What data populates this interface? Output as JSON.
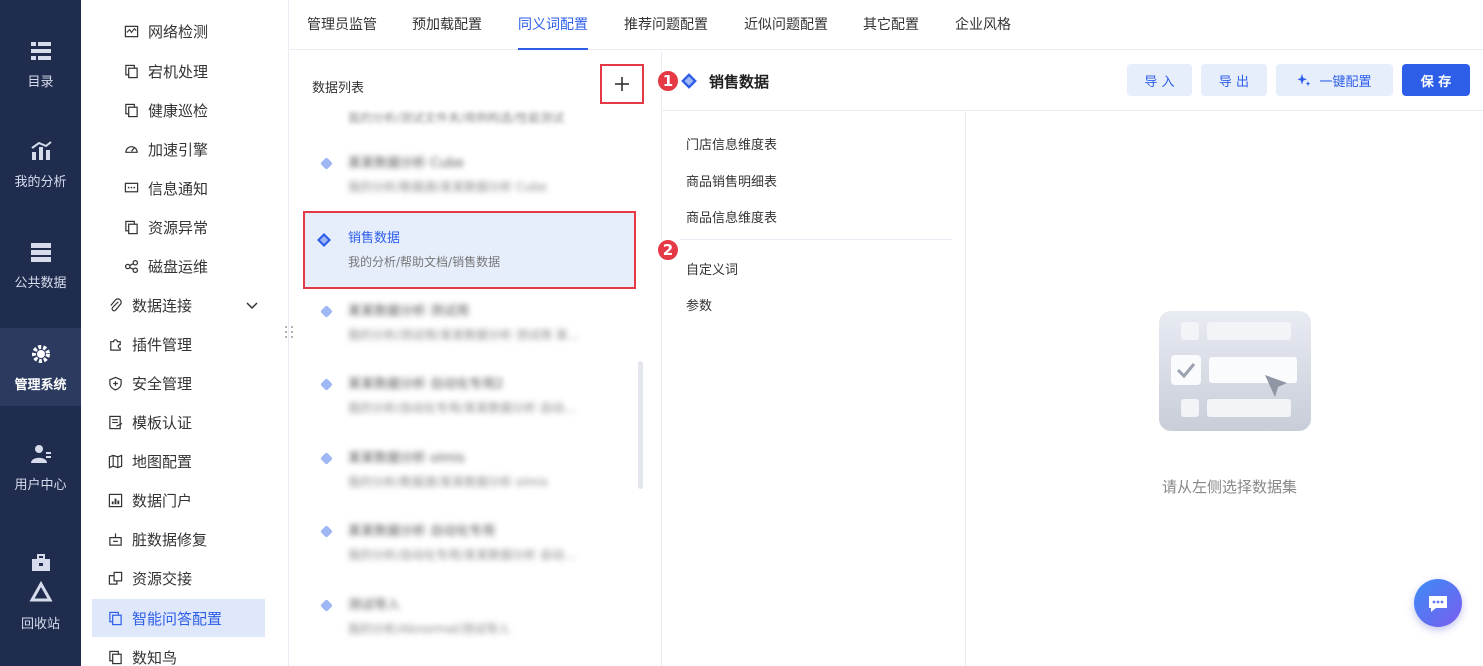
{
  "rail": {
    "items": [
      {
        "label": "目录",
        "icon": "catalog-icon"
      },
      {
        "label": "我的分析",
        "icon": "analysis-icon"
      },
      {
        "label": "公共数据",
        "icon": "public-data-icon"
      },
      {
        "label": "管理系统",
        "icon": "gear-icon",
        "active": true
      },
      {
        "label": "用户中心",
        "icon": "user-icon"
      },
      {
        "label": "回收站",
        "icon": "recycle-icon"
      }
    ]
  },
  "menu": {
    "sub_items": [
      {
        "label": "网络检测",
        "icon": "network-check-icon"
      },
      {
        "label": "宕机处理",
        "icon": "document-icon"
      },
      {
        "label": "健康巡检",
        "icon": "document-icon"
      },
      {
        "label": "加速引擎",
        "icon": "speed-icon"
      },
      {
        "label": "信息通知",
        "icon": "message-icon"
      },
      {
        "label": "资源异常",
        "icon": "document-icon"
      },
      {
        "label": "磁盘运维",
        "icon": "share-icon"
      }
    ],
    "top_items": [
      {
        "label": "数据连接",
        "icon": "paperclip-icon",
        "expandable": true
      },
      {
        "label": "插件管理",
        "icon": "puzzle-icon"
      },
      {
        "label": "安全管理",
        "icon": "shield-icon"
      },
      {
        "label": "模板认证",
        "icon": "template-icon"
      },
      {
        "label": "地图配置",
        "icon": "map-icon"
      },
      {
        "label": "数据门户",
        "icon": "portal-icon"
      },
      {
        "label": "脏数据修复",
        "icon": "repair-icon"
      },
      {
        "label": "资源交接",
        "icon": "handover-icon"
      },
      {
        "label": "智能问答配置",
        "icon": "document-icon",
        "active": true
      },
      {
        "label": "数知鸟",
        "icon": "document-icon"
      }
    ]
  },
  "tabs": [
    {
      "label": "管理员监管"
    },
    {
      "label": "预加载配置"
    },
    {
      "label": "同义词配置",
      "active": true
    },
    {
      "label": "推荐问题配置"
    },
    {
      "label": "近似问题配置"
    },
    {
      "label": "其它配置"
    },
    {
      "label": "企业风格"
    }
  ],
  "data_list": {
    "title": "数据列表",
    "partial_top": "我的分析/测试文件夹/用例构造/性能测试",
    "items": [
      {
        "name": "某某数据分析 Cube",
        "path": "我的分析/数据源/某某数据分析 Cube",
        "blurred": true
      },
      {
        "name": "销售数据",
        "path": "我的分析/帮助文档/销售数据",
        "selected": true
      },
      {
        "name": "某某数据分析 测试用",
        "path": "我的分析/测试用/某某数据分析 测试用 某...",
        "blurred": true
      },
      {
        "name": "某某数据分析 自动化专用2",
        "path": "我的分析/自动化专用/某某数据分析 自动...",
        "blurred": true
      },
      {
        "name": "某某数据分析 olmis",
        "path": "我的分析/数据源/某某数据分析 olmis",
        "blurred": true
      },
      {
        "name": "某某数据分析 自动化专用",
        "path": "我的分析/自动化专用/某某数据分析 自动...",
        "blurred": true
      },
      {
        "name": "测试导入",
        "path": "我的分析/Abnormal/测试导入",
        "blurred": true
      }
    ]
  },
  "detail": {
    "title": "销售数据",
    "buttons": {
      "import": "导 入",
      "export": "导 出",
      "one_click": "一键配置",
      "save": "保 存"
    },
    "tables": [
      "门店信息维度表",
      "商品销售明细表",
      "商品信息维度表"
    ],
    "extra": [
      "自定义词",
      "参数"
    ],
    "empty_text": "请从左侧选择数据集"
  },
  "badges": [
    "1",
    "2"
  ],
  "colors": {
    "accent": "#2d5ee8",
    "rail_bg": "#1f2c4d",
    "highlight": "#e63946",
    "active_bg": "#dfe7fa"
  }
}
